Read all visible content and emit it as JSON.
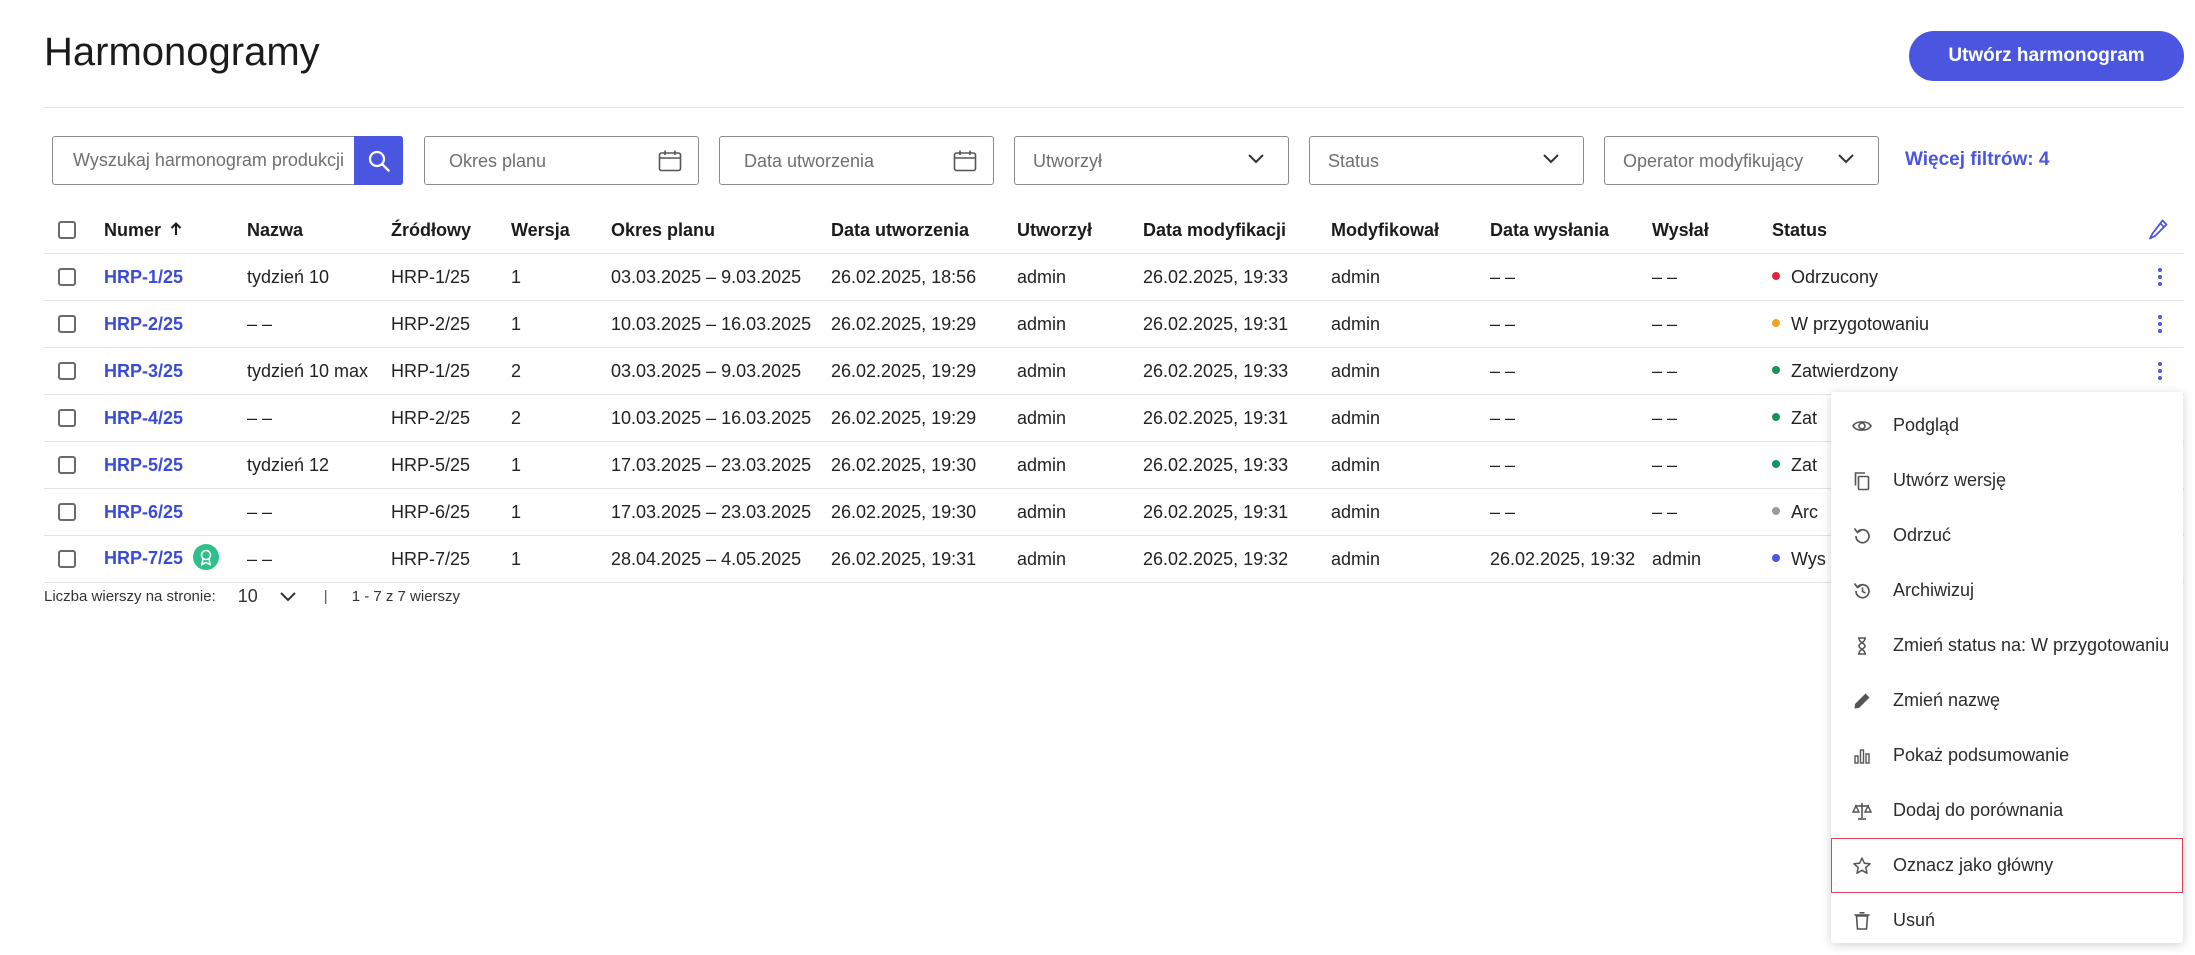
{
  "header": {
    "title": "Harmonogramy",
    "create_label": "Utwórz harmonogram"
  },
  "filters": {
    "search_placeholder": "Wyszukaj harmonogram produkcji",
    "plan_period": "Okres planu",
    "created_date": "Data utworzenia",
    "created_by": "Utworzył",
    "status": "Status",
    "operator": "Operator modyfikujący",
    "more": "Więcej filtrów: 4"
  },
  "table": {
    "columns": {
      "number": "Numer",
      "name": "Nazwa",
      "source": "Źródłowy",
      "version": "Wersja",
      "plan_period": "Okres planu",
      "created": "Data utworzenia",
      "created_by": "Utworzył",
      "modified": "Data modyfikacji",
      "modified_by": "Modyfikował",
      "sent": "Data wysłania",
      "sent_by": "Wysłał",
      "status": "Status"
    },
    "rows": [
      {
        "number": "HRP-1/25",
        "name": "tydzień 10",
        "source": "HRP-1/25",
        "version": "1",
        "period": "03.03.2025 – 9.03.2025",
        "created": "26.02.2025, 18:56",
        "created_by": "admin",
        "modified": "26.02.2025, 19:33",
        "modified_by": "admin",
        "sent": "– –",
        "sent_by": "– –",
        "status": "Odrzucony",
        "status_color": "#e0243b"
      },
      {
        "number": "HRP-2/25",
        "name": "– –",
        "source": "HRP-2/25",
        "version": "1",
        "period": "10.03.2025 – 16.03.2025",
        "created": "26.02.2025, 19:29",
        "created_by": "admin",
        "modified": "26.02.2025, 19:31",
        "modified_by": "admin",
        "sent": "– –",
        "sent_by": "– –",
        "status": "W przygotowaniu",
        "status_color": "#f2a427"
      },
      {
        "number": "HRP-3/25",
        "name": "tydzień 10 max",
        "source": "HRP-1/25",
        "version": "2",
        "period": "03.03.2025 – 9.03.2025",
        "created": "26.02.2025, 19:29",
        "created_by": "admin",
        "modified": "26.02.2025, 19:33",
        "modified_by": "admin",
        "sent": "– –",
        "sent_by": "– –",
        "status": "Zatwierdzony",
        "status_color": "#14935a"
      },
      {
        "number": "HRP-4/25",
        "name": "– –",
        "source": "HRP-2/25",
        "version": "2",
        "period": "10.03.2025 – 16.03.2025",
        "created": "26.02.2025, 19:29",
        "created_by": "admin",
        "modified": "26.02.2025, 19:31",
        "modified_by": "admin",
        "sent": "– –",
        "sent_by": "– –",
        "status": "Zat",
        "status_color": "#14935a"
      },
      {
        "number": "HRP-5/25",
        "name": "tydzień 12",
        "source": "HRP-5/25",
        "version": "1",
        "period": "17.03.2025 – 23.03.2025",
        "created": "26.02.2025, 19:30",
        "created_by": "admin",
        "modified": "26.02.2025, 19:33",
        "modified_by": "admin",
        "sent": "– –",
        "sent_by": "– –",
        "status": "Zat",
        "status_color": "#14935a"
      },
      {
        "number": "HRP-6/25",
        "name": "– –",
        "source": "HRP-6/25",
        "version": "1",
        "period": "17.03.2025 – 23.03.2025",
        "created": "26.02.2025, 19:30",
        "created_by": "admin",
        "modified": "26.02.2025, 19:31",
        "modified_by": "admin",
        "sent": "– –",
        "sent_by": "– –",
        "status": "Arc",
        "status_color": "#9a9a9a"
      },
      {
        "number": "HRP-7/25",
        "name": "– –",
        "source": "HRP-7/25",
        "version": "1",
        "period": "28.04.2025 – 4.05.2025",
        "created": "26.02.2025, 19:31",
        "created_by": "admin",
        "modified": "26.02.2025, 19:32",
        "modified_by": "admin",
        "sent": "26.02.2025, 19:32",
        "sent_by": "admin",
        "status": "Wys",
        "status_color": "#4a56e0",
        "badge": true
      }
    ]
  },
  "footer": {
    "rows_label": "Liczba wierszy na stronie:",
    "rows_value": "10",
    "range": "1 - 7 z 7 wierszy"
  },
  "menu": {
    "items": [
      {
        "label": "Podgląd",
        "icon": "eye-icon"
      },
      {
        "label": "Utwórz wersję",
        "icon": "copy-icon"
      },
      {
        "label": "Odrzuć",
        "icon": "undo-icon"
      },
      {
        "label": "Archiwizuj",
        "icon": "history-icon"
      },
      {
        "label": "Zmień status na: W przygotowaniu",
        "icon": "hourglass-icon"
      },
      {
        "label": "Zmień nazwę",
        "icon": "edit-icon"
      },
      {
        "label": "Pokaż podsumowanie",
        "icon": "bar-chart-icon"
      },
      {
        "label": "Dodaj do porównania",
        "icon": "scale-icon"
      },
      {
        "label": "Oznacz jako główny",
        "icon": "star-icon"
      },
      {
        "label": "Usuń",
        "icon": "trash-icon"
      }
    ]
  },
  "colors": {
    "accent": "#4a56e0",
    "badge": "#2fbf8a"
  }
}
